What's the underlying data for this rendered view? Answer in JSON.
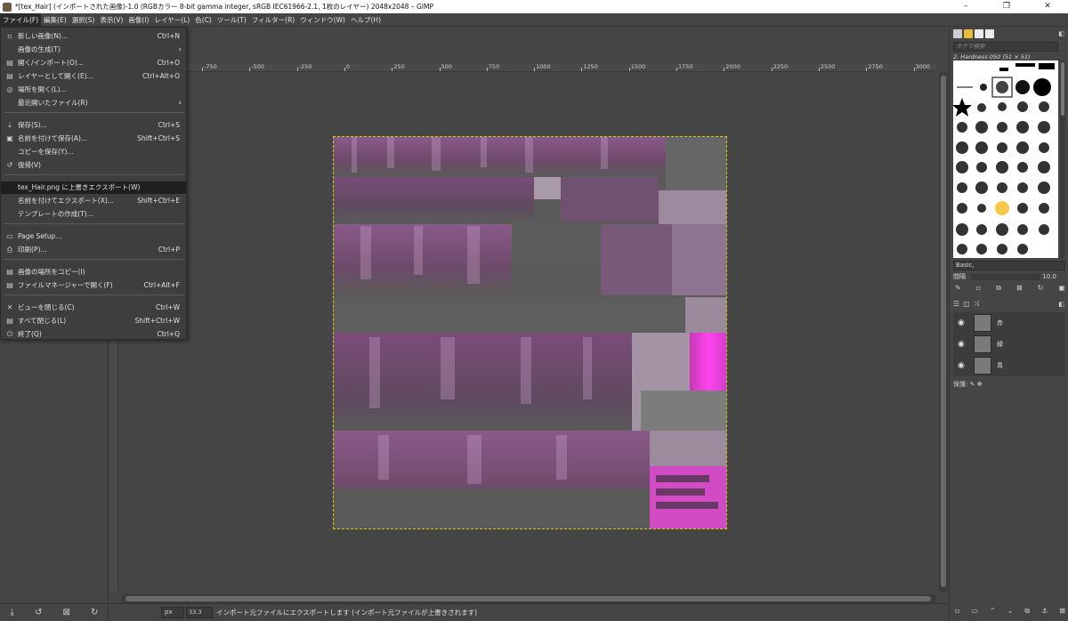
{
  "window": {
    "title": "*[tex_Hair] (インポートされた画像)-1.0 (RGBカラー 8-bit gamma integer, sRGB IEC61966-2.1, 1枚のレイヤー) 2048x2048 – GIMP",
    "minimize": "–",
    "maximize": "❐",
    "close": "✕"
  },
  "menubar": {
    "items": [
      {
        "label": "ファイル(F)"
      },
      {
        "label": "編集(E)"
      },
      {
        "label": "選択(S)"
      },
      {
        "label": "表示(V)"
      },
      {
        "label": "画像(I)"
      },
      {
        "label": "レイヤー(L)"
      },
      {
        "label": "色(C)"
      },
      {
        "label": "ツール(T)"
      },
      {
        "label": "フィルター(R)"
      },
      {
        "label": "ウィンドウ(W)"
      },
      {
        "label": "ヘルプ(H)"
      }
    ]
  },
  "file_menu": {
    "items": [
      {
        "icon": "new-image-icon",
        "glyph": "▫",
        "label": "新しい画像(N)...",
        "shortcut": "Ctrl+N"
      },
      {
        "icon": "",
        "glyph": "",
        "label": "画像の生成(T)",
        "shortcut": "",
        "submenu": "›"
      },
      {
        "icon": "open-icon",
        "glyph": "▤",
        "label": "開く/インポート(O)...",
        "shortcut": "Ctrl+O"
      },
      {
        "icon": "open-as-layers-icon",
        "glyph": "▤",
        "label": "レイヤーとして開く(E)...",
        "shortcut": "Ctrl+Alt+O"
      },
      {
        "icon": "open-location-icon",
        "glyph": "◎",
        "label": "場所を開く(L)...",
        "shortcut": ""
      },
      {
        "icon": "",
        "glyph": "",
        "label": "最近開いたファイル(R)",
        "shortcut": "",
        "submenu": "›"
      },
      {
        "icon": "save-icon",
        "glyph": "⤓",
        "label": "保存(S)...",
        "shortcut": "Ctrl+S"
      },
      {
        "icon": "save-as-icon",
        "glyph": "▣",
        "label": "名前を付けて保存(A)...",
        "shortcut": "Shift+Ctrl+S"
      },
      {
        "icon": "",
        "glyph": "",
        "label": "コピーを保存(Y)...",
        "shortcut": ""
      },
      {
        "icon": "revert-icon",
        "glyph": "↺",
        "label": "復帰(V)",
        "shortcut": ""
      },
      {
        "icon": "",
        "glyph": "",
        "label": "tex_Hair.png に上書きエクスポート(W)",
        "shortcut": ""
      },
      {
        "icon": "",
        "glyph": "",
        "label": "名前を付けてエクスポート(X)...",
        "shortcut": "Shift+Ctrl+E"
      },
      {
        "icon": "",
        "glyph": "",
        "label": "テンプレートの作成(T)...",
        "shortcut": ""
      },
      {
        "icon": "page-setup-icon",
        "glyph": "▭",
        "label": "Page Setup...",
        "shortcut": ""
      },
      {
        "icon": "print-icon",
        "glyph": "⎙",
        "label": "印刷(P)...",
        "shortcut": "Ctrl+P"
      },
      {
        "icon": "copy-location-icon",
        "glyph": "▤",
        "label": "画像の場所をコピー(I)",
        "shortcut": ""
      },
      {
        "icon": "file-manager-icon",
        "glyph": "▤",
        "label": "ファイルマネージャーで開く(F)",
        "shortcut": "Ctrl+Alt+F"
      },
      {
        "icon": "close-view-icon",
        "glyph": "✕",
        "label": "ビューを閉じる(C)",
        "shortcut": "Ctrl+W"
      },
      {
        "icon": "close-all-icon",
        "glyph": "▤",
        "label": "すべて閉じる(L)",
        "shortcut": "Shift+Ctrl+W"
      },
      {
        "icon": "quit-icon",
        "glyph": "⏻",
        "label": "終了(Q)",
        "shortcut": "Ctrl+Q"
      }
    ]
  },
  "ruler": {
    "labels": [
      "-750",
      "-500",
      "-250",
      "0",
      "250",
      "500",
      "750",
      "1000",
      "1250",
      "1500",
      "1750",
      "2000",
      "2250",
      "2500",
      "2750",
      "3000"
    ]
  },
  "statusbar": {
    "unit": "px",
    "zoom": "33.3",
    "message": "インポート元ファイルにエクスポートします (インポート元ファイルが上書きされます)"
  },
  "brushes": {
    "tag_placeholder": "タグで検索",
    "selected_name": "2. Hardness 050 (51 × 51)",
    "preset_combo": "Basic,",
    "spacing_label": "間隔",
    "spacing_value": "10.0"
  },
  "layers": {
    "items": [
      {
        "name": "赤"
      },
      {
        "name": "緑"
      },
      {
        "name": "青"
      }
    ],
    "lock_label": "保護:"
  },
  "colors": {
    "accent_pink": "#ee33dd",
    "canvas_gray": "#5a5a5a",
    "purple": "#7a4a78"
  }
}
